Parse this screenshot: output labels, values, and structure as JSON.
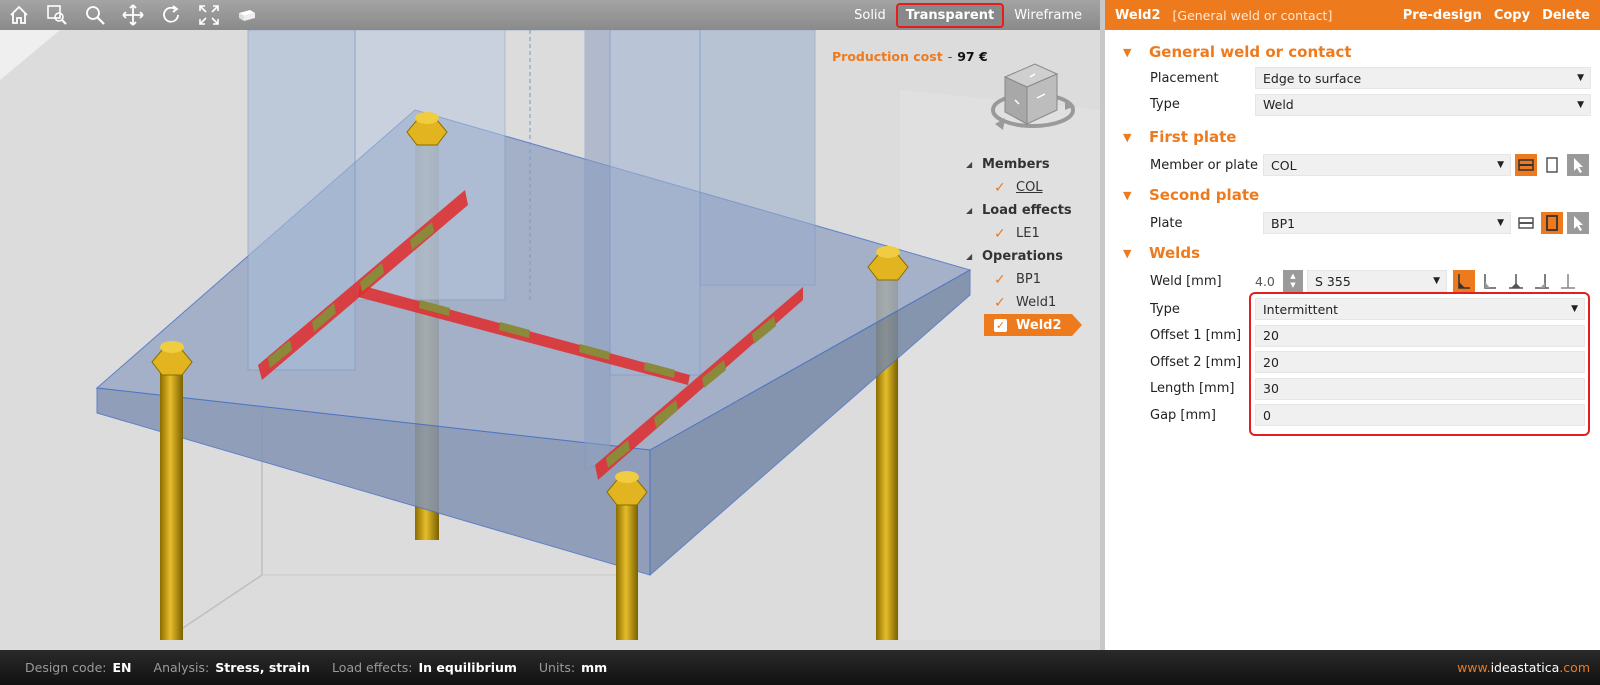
{
  "toolbar": {
    "icons": [
      "home-icon",
      "zoom-window-icon",
      "zoom-icon",
      "pan-icon",
      "rotate-icon",
      "fit-icon",
      "view-cube-icon"
    ],
    "view_modes": [
      "Solid",
      "Transparent",
      "Wireframe"
    ],
    "active_view_mode": "Transparent"
  },
  "cost": {
    "label": "Production cost",
    "separator": "-",
    "value": "97 €"
  },
  "tree": {
    "groups": [
      {
        "label": "Members",
        "items": [
          {
            "label": "COL"
          }
        ]
      },
      {
        "label": "Load effects",
        "items": [
          {
            "label": "LE1"
          }
        ]
      },
      {
        "label": "Operations",
        "items": [
          {
            "label": "BP1"
          },
          {
            "label": "Weld1"
          },
          {
            "label": "Weld2"
          }
        ]
      }
    ]
  },
  "panel": {
    "name": "Weld2",
    "description": "[General weld or contact]",
    "actions": {
      "predesign": "Pre-design",
      "copy": "Copy",
      "delete": "Delete"
    },
    "general": {
      "title": "General weld or contact",
      "placement_label": "Placement",
      "placement_value": "Edge to surface",
      "type_label": "Type",
      "type_value": "Weld"
    },
    "first_plate": {
      "title": "First plate",
      "label": "Member or plate",
      "value": "COL"
    },
    "second_plate": {
      "title": "Second plate",
      "label": "Plate",
      "value": "BP1"
    },
    "welds": {
      "title": "Welds",
      "weld_label": "Weld [mm]",
      "weld_size": "4.0",
      "material": "S 355",
      "type_label": "Type",
      "type_value": "Intermittent",
      "offset1_label": "Offset 1 [mm]",
      "offset1_value": "20",
      "offset2_label": "Offset 2 [mm]",
      "offset2_value": "20",
      "length_label": "Length [mm]",
      "length_value": "30",
      "gap_label": "Gap [mm]",
      "gap_value": "0"
    }
  },
  "status": {
    "design_code_label": "Design code:",
    "design_code_value": "EN",
    "analysis_label": "Analysis:",
    "analysis_value": "Stress, strain",
    "load_effects_label": "Load effects:",
    "load_effects_value": "In equilibrium",
    "units_label": "Units:",
    "units_value": "mm"
  },
  "brand": {
    "prefix": "www.",
    "name": "ideastatica",
    "suffix": ".com"
  },
  "colors": {
    "accent": "#ee7a1e",
    "highlight": "#e41e1e",
    "bolt": "#c9a014",
    "plate": "#9fb0cb"
  }
}
